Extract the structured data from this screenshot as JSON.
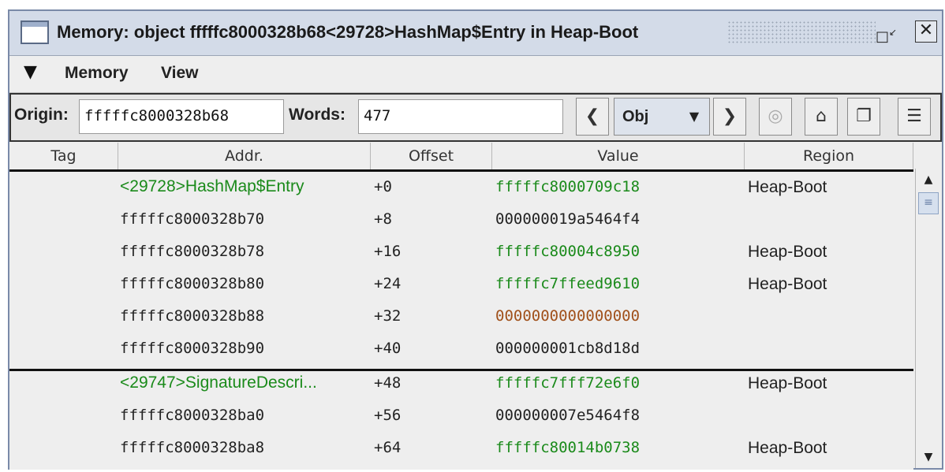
{
  "window": {
    "title": "Memory: object fffffc8000328b68<29728>HashMap$Entry in Heap-Boot",
    "restore_icon": "restore-icon",
    "close_icon": "close-icon"
  },
  "menubar": {
    "items": [
      {
        "label": "Memory"
      },
      {
        "label": "View"
      }
    ]
  },
  "toolbar": {
    "origin_label": "Origin:",
    "origin_value": "fffffc8000328b68",
    "words_label": "Words:",
    "words_value": "477",
    "mode_value": "Obj"
  },
  "table": {
    "columns": [
      "Tag",
      "Addr.",
      "Offset",
      "Value",
      "Region"
    ],
    "rows": [
      {
        "addr": "<29728>HashMap$Entry",
        "offset": "+0",
        "value": "fffffc8000709c18",
        "region": "Heap-Boot",
        "addr_color": "green",
        "value_color": "green"
      },
      {
        "addr": "fffffc8000328b70",
        "offset": "+8",
        "value": "000000019a5464f4",
        "region": "",
        "addr_color": "dark",
        "value_color": "dark"
      },
      {
        "addr": "fffffc8000328b78",
        "offset": "+16",
        "value": "fffffc80004c8950",
        "region": "Heap-Boot",
        "addr_color": "dark",
        "value_color": "green"
      },
      {
        "addr": "fffffc8000328b80",
        "offset": "+24",
        "value": "fffffc7ffeed9610",
        "region": "Heap-Boot",
        "addr_color": "dark",
        "value_color": "green"
      },
      {
        "addr": "fffffc8000328b88",
        "offset": "+32",
        "value": "0000000000000000",
        "region": "",
        "addr_color": "dark",
        "value_color": "brown"
      },
      {
        "addr": "fffffc8000328b90",
        "offset": "+40",
        "value": "000000001cb8d18d",
        "region": "",
        "addr_color": "dark",
        "value_color": "dark"
      },
      {
        "addr": "<29747>SignatureDescri...",
        "offset": "+48",
        "value": "fffffc7fff72e6f0",
        "region": "Heap-Boot",
        "addr_color": "green",
        "value_color": "green"
      },
      {
        "addr": "fffffc8000328ba0",
        "offset": "+56",
        "value": "000000007e5464f8",
        "region": "",
        "addr_color": "dark",
        "value_color": "dark"
      },
      {
        "addr": "fffffc8000328ba8",
        "offset": "+64",
        "value": "fffffc80014b0738",
        "region": "Heap-Boot",
        "addr_color": "dark",
        "value_color": "green"
      }
    ]
  },
  "colors": {
    "green": "#1a8a1a",
    "brown": "#a0501a",
    "titlebar": "#d3dbe8"
  }
}
